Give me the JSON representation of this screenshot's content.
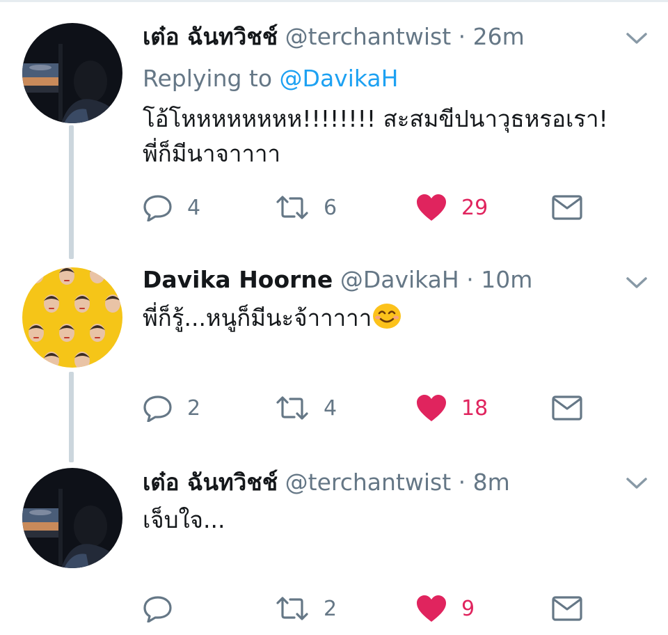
{
  "tweets": [
    {
      "name": "เต๋อ ฉันทวิชช์",
      "handle": "@terchantwist",
      "time": "26m",
      "replying_label": "Replying to",
      "replying_mention": "@DavikaH",
      "lines": [
        "โอ้โหหหหหหหห!!!!!!!! สะสมขีปนาวุธหรอเรา!",
        "พี่ก็มีนาจาาาา"
      ],
      "replies": "4",
      "retweets": "6",
      "likes": "29",
      "avatar": "person-silhouette-window-sunset"
    },
    {
      "name": "Davika Hoorne",
      "handle": "@DavikaH",
      "time": "10m",
      "lines": [
        "พี่ก็รู้...หนูก็มีนะจ้าาาาา"
      ],
      "emoji": "smiling-face-emoji",
      "replies": "2",
      "retweets": "4",
      "likes": "18",
      "avatar": "yellow-pattern-faces"
    },
    {
      "name": "เต๋อ ฉันทวิชช์",
      "handle": "@terchantwist",
      "time": "8m",
      "lines": [
        "เจ็บใจ..."
      ],
      "replies": "",
      "retweets": "2",
      "likes": "9",
      "avatar": "person-silhouette-window-sunset"
    }
  ],
  "separator": "·",
  "colors": {
    "like": "#e0245e",
    "handle": "#657786",
    "mention": "#1da1f2",
    "thread_line": "#ccd6dd",
    "avatar_yellow": "#f5c518"
  },
  "icons": [
    "reply-icon",
    "retweet-icon",
    "like-heart-icon",
    "message-envelope-icon",
    "chevron-down-icon"
  ]
}
